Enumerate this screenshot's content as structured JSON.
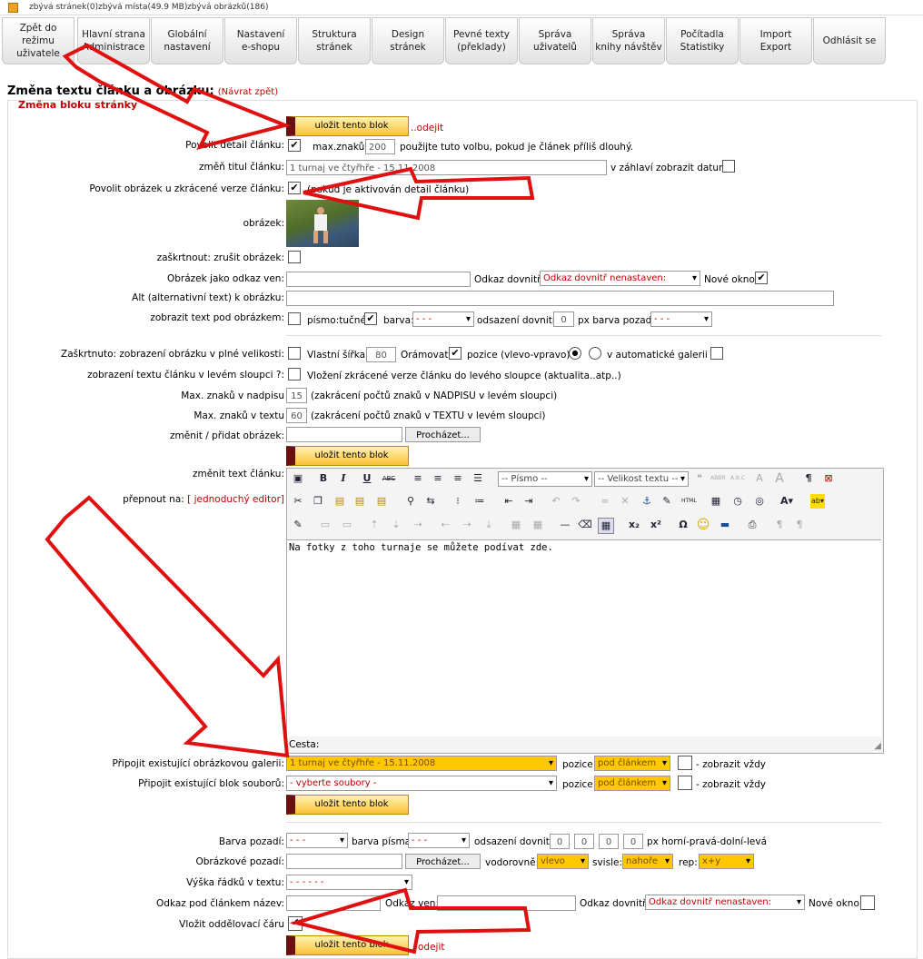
{
  "topbar": {
    "pages_left": "zbývá stránek(0)",
    "space_left": "zbývá místa(49.9 MB)",
    "images_left": "zbývá obrázků(186)"
  },
  "nav": [
    {
      "label": "Zpět do režimu\nuživatele"
    },
    {
      "label": "Hlavní strana\nAdministrace"
    },
    {
      "label": "Globální\nnastavení"
    },
    {
      "label": "Nastavení\ne-shopu"
    },
    {
      "label": "Struktura\nstránek"
    },
    {
      "label": "Design\nstránek"
    },
    {
      "label": "Pevné texty\n(překlady)"
    },
    {
      "label": "Správa\nuživatelů"
    },
    {
      "label": "Správa\nknihy návštěv"
    },
    {
      "label": "Počítadla\nStatistiky"
    },
    {
      "label": "Import\nExport"
    },
    {
      "label": "Odhlásit se"
    }
  ],
  "page": {
    "title": "Změna textu článku a obrázku:",
    "back": "(Návrat zpět)",
    "block_title": "Změna bloku stránky"
  },
  "save_label": "uložit tento blok",
  "leave_label": "..odejit",
  "leave_label2": "odejit",
  "form": {
    "allow_detail": "Povolit detail článku:",
    "max_chars": "max.znaků:",
    "max_chars_val": "200",
    "max_chars_hint": "použijte tuto volbu, pokud je článek příliš dlouhý.",
    "change_title": "změň titul článku:",
    "title_val": "1 turnaj ve čtyřhře - 15.11.2008",
    "show_date": "v záhlaví zobrazit datum:",
    "allow_image": "Povolit obrázek u zkrácené verze článku:",
    "allow_image_hint": "(pokud je aktivován detail článku)",
    "image": "obrázek:",
    "remove_image": "zaškrtnout: zrušit obrázek:",
    "image_link": "Obrázek jako odkaz ven:",
    "link_in": "Odkaz dovnitř:",
    "link_in_val": "Odkaz dovnitř nenastaven:",
    "new_window": "Nové okno:",
    "alt": "Alt (alternativní text) k obrázku:",
    "text_under": "zobrazit text pod obrázkem:",
    "bold": "písmo:tučné:",
    "color": "barva:",
    "dash": "- - -",
    "indent": "odsazení dovnitř:",
    "indent_val": "0",
    "bg_color": "px barva pozadí:",
    "full_size": "Zaškrtnuto: zobrazení obrázku v plné velikosti:",
    "own_width": "Vlastní šířka:",
    "own_width_val": "80",
    "frame": "Orámovat:",
    "position": "pozice (vlevo-vpravo):",
    "auto_gallery": "v automatické galerii ?:",
    "left_column": "zobrazení textu článku v levém sloupci ?:",
    "left_column_hint": "Vložení zkrácené verze článku do levého sloupce (aktualita..atp..)",
    "max_title": "Max. znaků v nadpisu",
    "max_title_val": "15",
    "max_title_hint": "(zakrácení počtů znaků v NADPISU v levém sloupci)",
    "max_text": "Max. znaků v textu",
    "max_text_val": "60",
    "max_text_hint": "(zakrácení počtů znaků v TEXTU v levém sloupci)",
    "change_image": "změnit / přidat obrázek:",
    "browse": "Procházet...",
    "change_text": "změnit text článku:",
    "switch": "přepnout na:",
    "simple_editor": "[ jednoduchý editor]",
    "font_sel": "-- Písmo --",
    "size_sel": "-- Velikost textu --",
    "editor_text": "Na fotky z toho turnaje se můžete podívat zde.",
    "path": "Cesta:",
    "attach_gallery": "Připojit existující obrázkovou galerii:",
    "gallery_val": "1 turnaj ve čtyřhře - 15.11.2008",
    "pos": "pozice:",
    "pos_val": "pod článkem",
    "always": "- zobrazit vždy",
    "attach_files": "Připojit existující blok souborů:",
    "files_val": "- vyberte soubory -",
    "bg": "Barva pozadí:",
    "font_color": "barva písma:",
    "indent2": "odsazení dovnitř:",
    "pad": [
      "0",
      "0",
      "0",
      "0"
    ],
    "pad_hint": "px horní-pravá-dolní-levá",
    "bg_image": "Obrázkové pozadí:",
    "horiz": "vodorovně:",
    "horiz_val": "vlevo",
    "vert": "svisle:",
    "vert_val": "nahoře",
    "rep": "rep:",
    "rep_val": "x+y",
    "line_height": "Výška řádků v textu:",
    "line_height_val": "- - - - - -",
    "link_name": "Odkaz pod článkem název:",
    "link_out": "Odkaz ven:",
    "link_in2": "Odkaz dovnitř:",
    "new_window2": "Nové okno:",
    "separator": "Vložit oddělovací čáru"
  },
  "colors": {
    "accent": "#c00000",
    "button": "#f9c23a",
    "arrow": "#e01010",
    "select_highlight": "#ffc800"
  }
}
